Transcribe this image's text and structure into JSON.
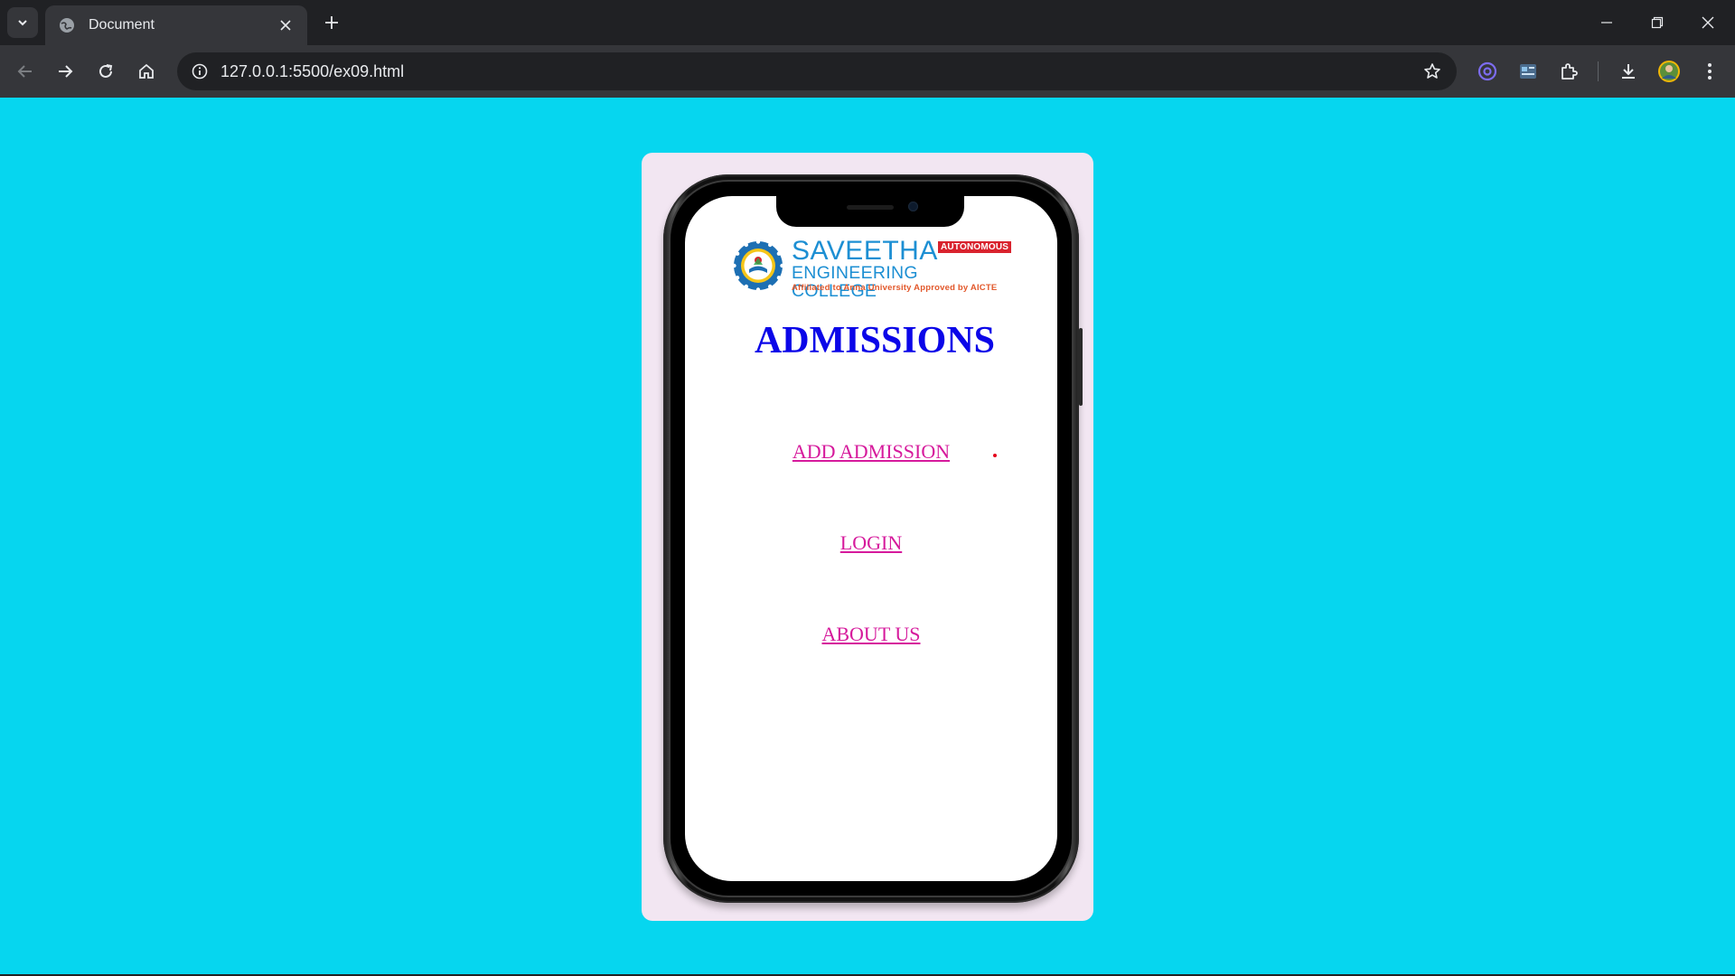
{
  "browser": {
    "tab_title": "Document",
    "url": "127.0.0.1:5500/ex09.html"
  },
  "page": {
    "background": "#06d6ef",
    "card_background": "#f2e6f2",
    "logo": {
      "name": "SAVEETHA",
      "badge": "AUTONOMOUS",
      "college": "ENGINEERING COLLEGE",
      "tagline": "Affiliated to Anna University   Approved by AICTE"
    },
    "heading": "ADMISSIONS",
    "heading_color": "#0b06e8",
    "link_color": "#d61a9c",
    "links": [
      {
        "label": "ADD ADMISSION"
      },
      {
        "label": "LOGIN"
      },
      {
        "label": "ABOUT US"
      }
    ]
  }
}
